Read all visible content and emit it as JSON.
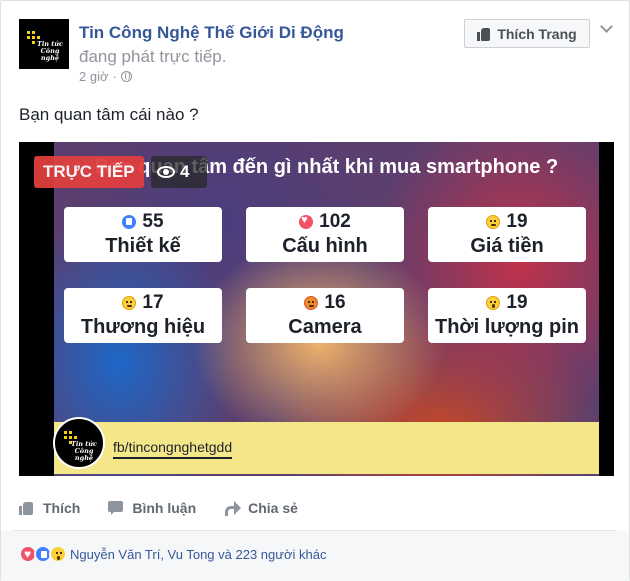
{
  "header": {
    "page_name": "Tin Công Nghệ Thế Giới Di Động",
    "action": "đang phát trực tiếp.",
    "time": "2 giờ",
    "separator": "·",
    "like_page_label": "Thích Trang",
    "avatar_text": "Tin tức Công nghệ"
  },
  "post": {
    "text": "Bạn quan tâm cái nào ?"
  },
  "video": {
    "question": "Bạn quan tâm đến gì nhất khi mua smartphone ?",
    "live_label": "TRỰC TIẾP",
    "viewers": "4",
    "options": [
      {
        "reaction": "like",
        "count": "55",
        "label": "Thiết kế"
      },
      {
        "reaction": "love",
        "count": "102",
        "label": "Cấu hình"
      },
      {
        "reaction": "sad",
        "count": "19",
        "label": "Giá tiền"
      },
      {
        "reaction": "haha",
        "count": "17",
        "label": "Thương hiệu"
      },
      {
        "reaction": "angry",
        "count": "16",
        "label": "Camera"
      },
      {
        "reaction": "wow",
        "count": "19",
        "label": "Thời lượng pin"
      }
    ],
    "signature_url": "fb/tincongnghetgdd"
  },
  "actions": {
    "like": "Thích",
    "comment": "Bình luận",
    "share": "Chia sẻ"
  },
  "summary": {
    "text": "Nguyễn Văn Trí, Vu Tong và 223 người khác"
  }
}
